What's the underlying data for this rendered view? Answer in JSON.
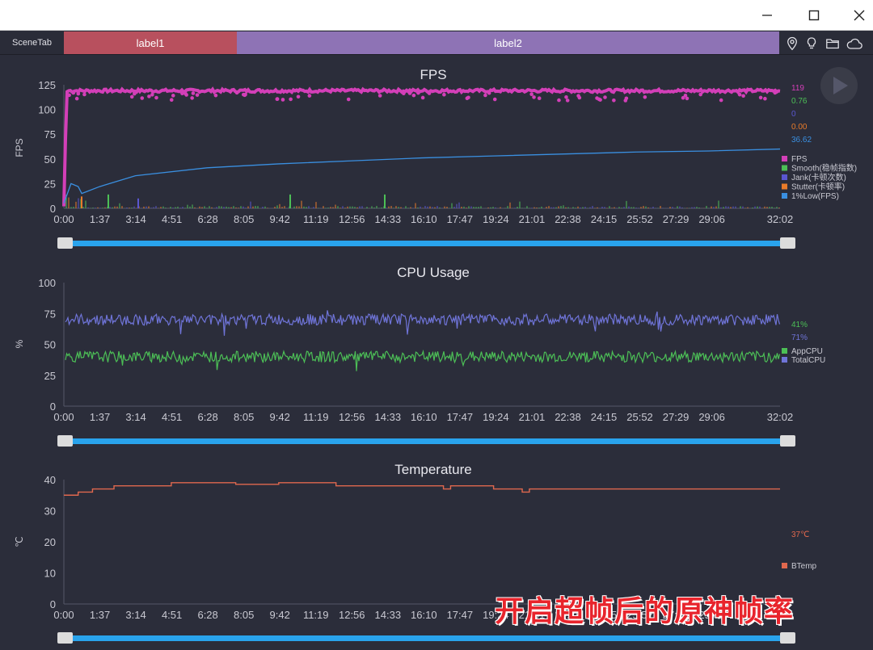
{
  "window": {
    "minimize_icon": "minimize-icon",
    "maximize_icon": "maximize-icon",
    "close_icon": "close-icon"
  },
  "tabbar": {
    "scene_tab": "SceneTab",
    "label1": "label1",
    "label2": "label2",
    "label1_color": "#b8505e",
    "label2_color": "#8e73b5",
    "icons": [
      "location-pin-icon",
      "lightbulb-icon",
      "folder-icon",
      "cloud-icon"
    ]
  },
  "time_ticks": [
    "0:00",
    "1:37",
    "3:14",
    "4:51",
    "6:28",
    "8:05",
    "9:42",
    "11:19",
    "12:56",
    "14:33",
    "16:10",
    "17:47",
    "19:24",
    "21:01",
    "22:38",
    "24:15",
    "25:52",
    "27:29",
    "29:06",
    "32:02"
  ],
  "chart_data": [
    {
      "type": "line",
      "title": "FPS",
      "ylabel": "FPS",
      "yticks": [
        "125",
        "100",
        "75",
        "50",
        "25",
        "0"
      ],
      "ylim": [
        0,
        125
      ],
      "series": [
        {
          "name": "FPS",
          "color": "#d33fb8",
          "current": "119"
        },
        {
          "name": "Smooth(稳帧指数)",
          "color": "#4cbf56",
          "current": "0.76"
        },
        {
          "name": "Jank(卡顿次数)",
          "color": "#5a56d0",
          "current": "0"
        },
        {
          "name": "Stutter(卡顿率)",
          "color": "#e87b2a",
          "current": "0.00"
        },
        {
          "name": "1%Low(FPS)",
          "color": "#3a8fe0",
          "current": "36.62"
        }
      ],
      "fps_level": 119,
      "low1_points": [
        [
          0,
          5
        ],
        [
          0.01,
          25
        ],
        [
          0.02,
          22
        ],
        [
          0.025,
          15
        ],
        [
          0.05,
          22
        ],
        [
          0.1,
          33
        ],
        [
          0.2,
          41
        ],
        [
          0.3,
          45
        ],
        [
          0.4,
          48
        ],
        [
          0.5,
          51
        ],
        [
          0.6,
          53
        ],
        [
          0.7,
          55
        ],
        [
          0.8,
          57
        ],
        [
          0.9,
          58
        ],
        [
          1.0,
          60
        ]
      ]
    },
    {
      "type": "line",
      "title": "CPU Usage",
      "ylabel": "%",
      "yticks": [
        "100",
        "75",
        "50",
        "25",
        "0"
      ],
      "ylim": [
        0,
        100
      ],
      "series": [
        {
          "name": "AppCPU",
          "color": "#4cbf56",
          "current": "41%",
          "level": 40
        },
        {
          "name": "TotalCPU",
          "color": "#6f74d8",
          "current": "71%",
          "level": 70
        }
      ]
    },
    {
      "type": "line",
      "title": "Temperature",
      "ylabel": "℃",
      "yticks": [
        "40",
        "30",
        "20",
        "10",
        "0"
      ],
      "ylim": [
        0,
        40
      ],
      "series": [
        {
          "name": "BTemp",
          "color": "#e0684e",
          "current": "37℃"
        }
      ],
      "points": [
        [
          0,
          35
        ],
        [
          0.02,
          36
        ],
        [
          0.04,
          37
        ],
        [
          0.07,
          38
        ],
        [
          0.15,
          39
        ],
        [
          0.24,
          38.5
        ],
        [
          0.3,
          39
        ],
        [
          0.38,
          38
        ],
        [
          0.52,
          38
        ],
        [
          0.53,
          37
        ],
        [
          0.54,
          38
        ],
        [
          0.6,
          37
        ],
        [
          0.64,
          36
        ],
        [
          0.65,
          37
        ],
        [
          1.0,
          37
        ]
      ]
    }
  ],
  "overlay_caption": "开启超帧后的原神帧率"
}
